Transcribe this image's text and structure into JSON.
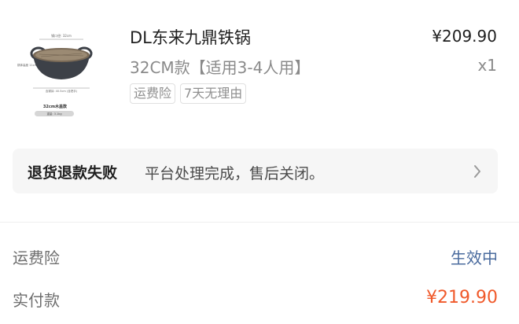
{
  "product": {
    "title": "DL东来九鼎铁锅",
    "price": "¥209.90",
    "spec": "32CM款【适用3-4人用】",
    "quantity": "x1",
    "tags": [
      "运费险",
      "7天无理由"
    ],
    "thumbnail": {
      "caption": "32cm木盖款",
      "sub_caption": "重量: 3.1kg",
      "dim_top": "锅口径: 32cm",
      "dim_side": "锅体高度 11cm",
      "dim_bottom": "含锅耳: 40.5cm (含把手)"
    }
  },
  "after_sale": {
    "status": "退货退款失败",
    "description": "平台处理完成，售后关闭。"
  },
  "summary": {
    "insurance_label": "运费险",
    "insurance_value": "生效中",
    "paid_label": "实付款",
    "paid_value": "¥219.90"
  },
  "colors": {
    "accent_price": "#f0592a",
    "status_link": "#4a6b9e"
  }
}
